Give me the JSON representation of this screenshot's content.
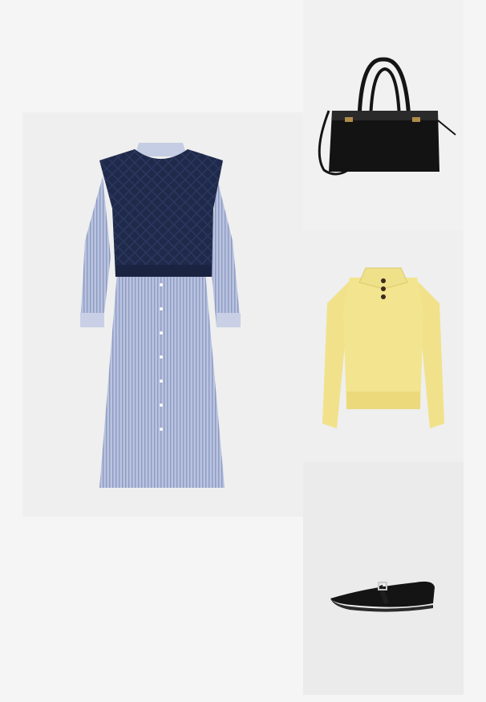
{
  "background_color": "#f5f5f5",
  "items": [
    {
      "id": "dress",
      "icon": "striped-shirt-dress-with-cable-knit-vest-image",
      "tile_color": "#efefef"
    },
    {
      "id": "bag",
      "icon": "black-leather-handbag-image",
      "tile_color": "#f1f1f1"
    },
    {
      "id": "sweater",
      "icon": "yellow-polo-sweater-image",
      "tile_color": "#efefef"
    },
    {
      "id": "shoe",
      "icon": "black-mary-jane-flat-image",
      "tile_color": "#ebebeb"
    }
  ]
}
